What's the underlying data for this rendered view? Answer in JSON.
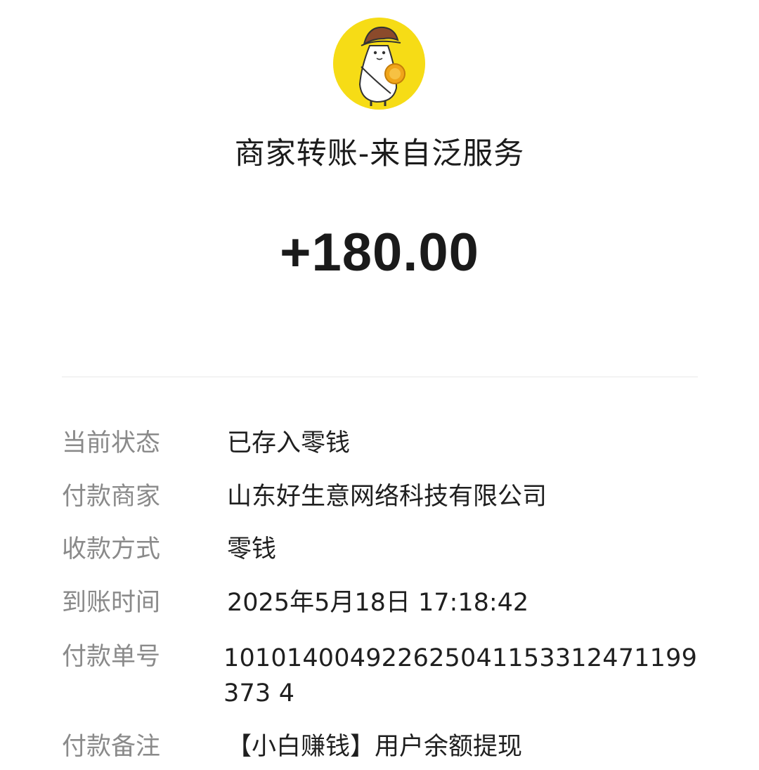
{
  "header": {
    "avatar_icon": "merchant-mascot-avatar",
    "avatar_bg": "#f6dc16",
    "title": "商家转账-来自泛服务",
    "amount": "+180.00"
  },
  "details": [
    {
      "label": "当前状态",
      "value": "已存入零钱"
    },
    {
      "label": "付款商家",
      "value": "山东好生意网络科技有限公司"
    },
    {
      "label": "收款方式",
      "value": "零钱"
    },
    {
      "label": "到账时间",
      "value": "2025年5月18日 17:18:42"
    },
    {
      "label": "付款单号",
      "value": "101014004922625041153312471199373 4"
    },
    {
      "label": "付款备注",
      "value": "【小白赚钱】用户余额提现"
    }
  ]
}
